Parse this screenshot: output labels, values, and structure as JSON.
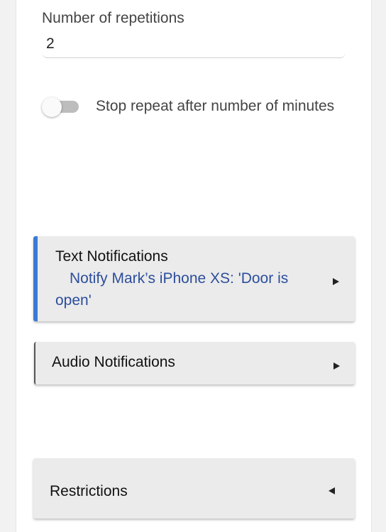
{
  "repetitions": {
    "label": "Number of repetitions",
    "value": "2"
  },
  "stop_repeat": {
    "label": "Stop repeat after number of minutes",
    "enabled": false
  },
  "sections": {
    "text_notifications": {
      "title": "Text Notifications",
      "summary": "Notify Mark’s iPhone XS: 'Door is open'",
      "expanded": false,
      "accent_color": "#3a7bd5",
      "arrow_icon": "triangle-right-icon"
    },
    "audio_notifications": {
      "title": "Audio Notifications",
      "expanded": false,
      "arrow_icon": "triangle-right-icon"
    },
    "restrictions": {
      "title": "Restrictions",
      "expanded": true,
      "arrow_icon": "triangle-left-icon"
    }
  },
  "colors": {
    "summary_text": "#2c4e9c",
    "section_bg": "#ebebeb"
  }
}
